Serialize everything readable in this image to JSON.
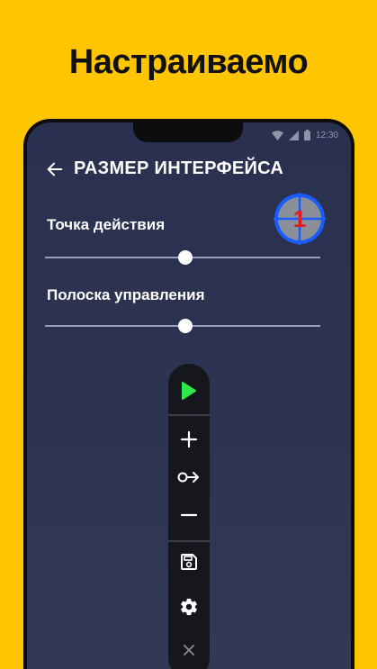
{
  "promo": {
    "headline": "Настраиваемо"
  },
  "status_bar": {
    "time": "12:30"
  },
  "app_bar": {
    "title": "РАЗМЕР ИНТЕРФЕЙСА",
    "back_icon": "arrow-left-icon"
  },
  "target_marker": {
    "number": "1",
    "ring_color": "#1a5cff",
    "number_color": "#e31b1b"
  },
  "settings": [
    {
      "label": "Точка действия",
      "slider_value": 0.51
    },
    {
      "label": "Полоска управления",
      "slider_value": 0.51
    }
  ],
  "toolbar": {
    "buttons": [
      {
        "icon": "play-icon",
        "color": "#2ee84a"
      },
      {
        "icon": "plus-icon"
      },
      {
        "icon": "swipe-arrow-icon"
      },
      {
        "icon": "minus-icon"
      },
      {
        "icon": "save-icon"
      },
      {
        "icon": "gear-icon"
      },
      {
        "icon": "close-icon"
      }
    ]
  }
}
